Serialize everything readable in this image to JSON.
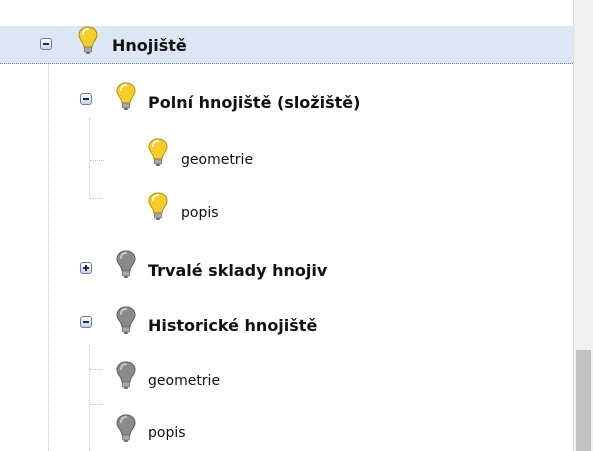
{
  "tree": {
    "nodes": [
      {
        "label": "Hnojiště",
        "state": "expanded",
        "lit": true,
        "selected": true
      },
      {
        "label": "Polní hnojiště (složiště)",
        "state": "expanded",
        "lit": true
      },
      {
        "label": "geometrie",
        "state": "leaf",
        "lit": true
      },
      {
        "label": "popis",
        "state": "leaf",
        "lit": true
      },
      {
        "label": "Trvalé sklady hnojiv",
        "state": "collapsed",
        "lit": false
      },
      {
        "label": "Historické hnojiště",
        "state": "expanded",
        "lit": false
      },
      {
        "label": "geometrie",
        "state": "leaf",
        "lit": false
      },
      {
        "label": "popis",
        "state": "leaf",
        "lit": false
      }
    ]
  },
  "colors": {
    "bulb_on": "#f7cd2a",
    "bulb_off": "#8a8a8a",
    "selection": "#dde6f4"
  },
  "icons": {
    "expanded": "minus-toggle-icon",
    "collapsed": "plus-toggle-icon",
    "layer_visible": "lightbulb-on-icon",
    "layer_hidden": "lightbulb-off-icon"
  }
}
